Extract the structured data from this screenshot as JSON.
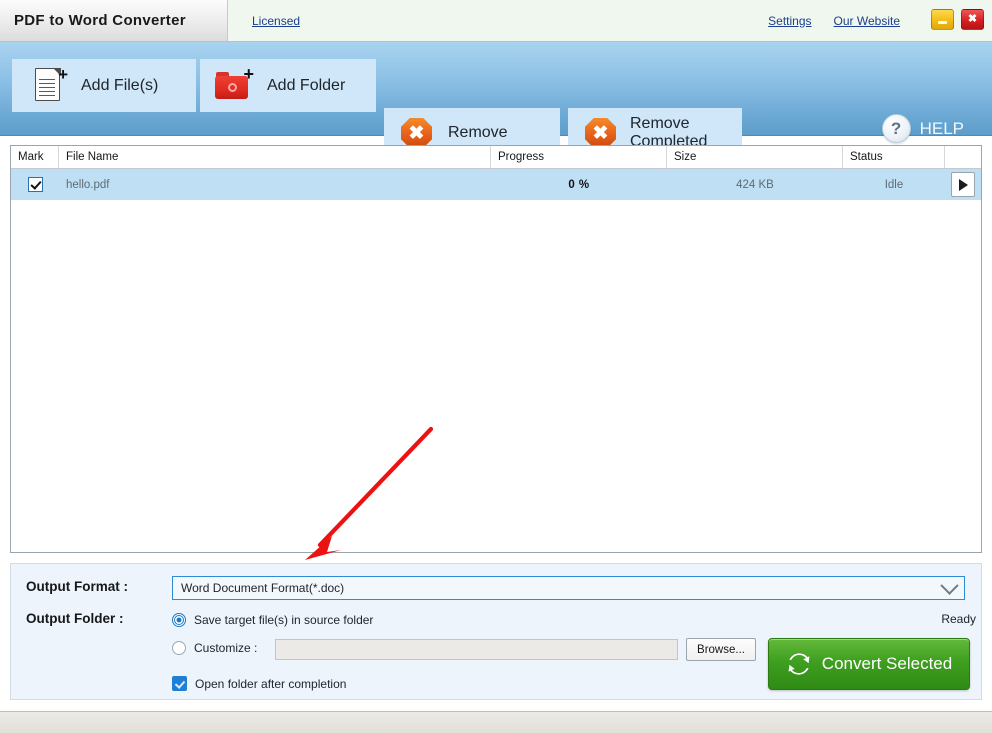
{
  "window": {
    "title": "PDF to Word Converter",
    "license_link": "Licensed",
    "settings_link": "Settings",
    "website_link": "Our Website",
    "minimize_icon": "minimize-icon",
    "close_icon": "close-icon",
    "close_glyph": "✖"
  },
  "toolbar": {
    "add_files_label": "Add File(s)",
    "add_files_icon": "page-plus-icon",
    "add_folder_label": "Add Folder",
    "add_folder_icon": "folder-plus-icon",
    "remove_label": "Remove",
    "remove_icon": "remove-octagon-icon",
    "remove_completed_label": "Remove\nCompleted",
    "remove_completed_icon": "remove-octagon-icon",
    "help_label": "HELP",
    "help_icon": "question-circle-icon",
    "help_glyph": "?",
    "plus_glyph": "+"
  },
  "file_list": {
    "columns": [
      "Mark",
      "File Name",
      "Progress",
      "Size",
      "Status",
      ""
    ],
    "rows": [
      {
        "marked": true,
        "file_name": "hello.pdf",
        "progress": "0 %",
        "size": "424 KB",
        "status": "Idle",
        "action_icon": "play-icon"
      }
    ]
  },
  "output": {
    "format_label": "Output Format :",
    "format_value": "Word Document Format(*.doc)",
    "format_chevron_icon": "chevron-down-icon",
    "folder_label": "Output Folder :",
    "radio_source_label": "Save target file(s) in source folder",
    "radio_source_selected": true,
    "radio_custom_label": "Customize :",
    "radio_custom_selected": false,
    "custom_path_value": "",
    "browse_label": "Browse...",
    "open_folder_label": "Open folder after completion",
    "open_folder_checked": true,
    "status_text": "Ready",
    "convert_label": "Convert Selected",
    "convert_icon": "refresh-circular-icon"
  },
  "annotation": {
    "arrow_icon": "red-arrow-annotation",
    "color": "#ee1111"
  },
  "colors": {
    "titlebar_bg": "#f0f7ee",
    "toolbar_top": "#a9d3ef",
    "toolbar_bottom": "#5e9ecb",
    "toolbar_button": "#cfe7f9",
    "row_selected": "#bfdff5",
    "panel_bg": "#eef4fb",
    "convert_green": "#3f9f20",
    "link_blue": "#1b3f8f",
    "accent_blue": "#2e8bd6"
  }
}
